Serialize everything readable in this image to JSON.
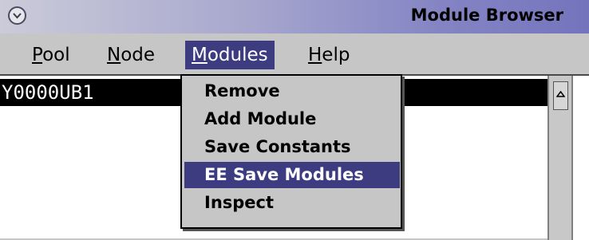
{
  "window": {
    "title": "Module Browser",
    "menu_icon": "chevron-down-icon"
  },
  "menubar": {
    "items": [
      {
        "first": "P",
        "rest": "ool"
      },
      {
        "first": "N",
        "rest": "ode"
      },
      {
        "first": "M",
        "rest": "odules"
      },
      {
        "first": "H",
        "rest": "elp"
      }
    ]
  },
  "list": {
    "rows": [
      "Y0000UB1"
    ]
  },
  "scrollbar": {
    "up_icon": "arrow-up-icon"
  },
  "dropdown": {
    "items": [
      "Remove",
      "Add Module",
      "Save Constants",
      "EE Save Modules",
      "Inspect"
    ],
    "highlighted": "EE Save Modules"
  },
  "colors": {
    "highlight": "#3e3c80",
    "menu_bg": "#c6c6c6"
  }
}
